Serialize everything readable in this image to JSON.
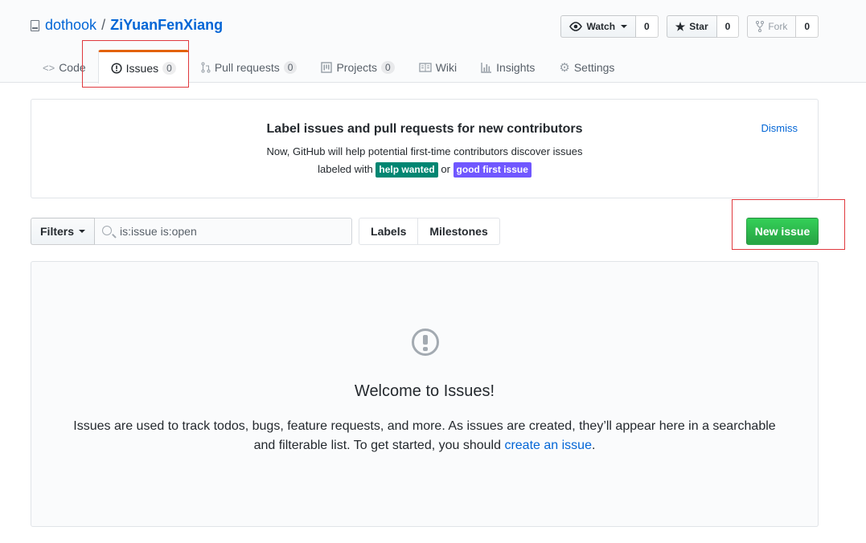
{
  "repo": {
    "owner": "dothook",
    "separator": "/",
    "name": "ZiYuanFenXiang"
  },
  "actions": {
    "watch_label": "Watch",
    "watch_count": "0",
    "star_label": "Star",
    "star_count": "0",
    "fork_label": "Fork",
    "fork_count": "0"
  },
  "nav": {
    "code": "Code",
    "issues": "Issues",
    "issues_count": "0",
    "pulls": "Pull requests",
    "pulls_count": "0",
    "projects": "Projects",
    "projects_count": "0",
    "wiki": "Wiki",
    "insights": "Insights",
    "settings": "Settings"
  },
  "banner": {
    "title": "Label issues and pull requests for new contributors",
    "line1": "Now, GitHub will help potential first-time contributors discover issues",
    "line2_prefix": "labeled with",
    "label1": "help wanted",
    "label1_color": "#008672",
    "or_text": "or",
    "label2": "good first issue",
    "label2_color": "#7057ff",
    "dismiss": "Dismiss"
  },
  "subnav": {
    "filters": "Filters",
    "search_value": "is:issue is:open",
    "labels": "Labels",
    "milestones": "Milestones",
    "new_issue": "New issue"
  },
  "blankslate": {
    "title": "Welcome to Issues!",
    "body_before": "Issues are used to track todos, bugs, feature requests, and more. As issues are created, they’ll appear here in a searchable and filterable list. To get started, you should ",
    "link": "create an issue",
    "body_after": "."
  },
  "colors": {
    "accent": "#0366d6",
    "primary_button": "#28a745",
    "selected_tab_border": "#e36209",
    "highlight": "#e0393e"
  }
}
